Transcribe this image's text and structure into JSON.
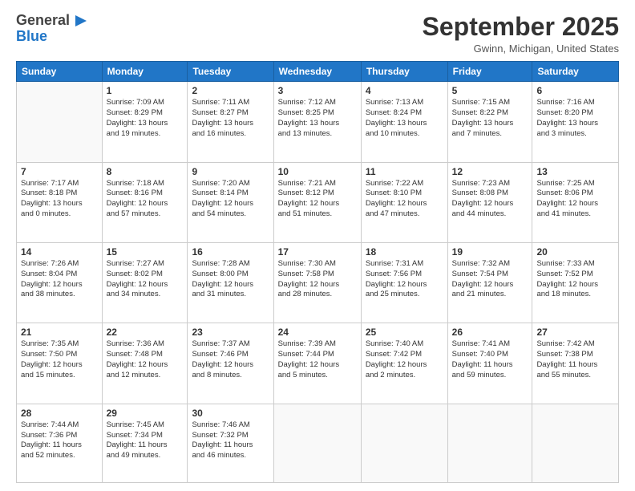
{
  "header": {
    "logo_general": "General",
    "logo_blue": "Blue",
    "month_title": "September 2025",
    "location": "Gwinn, Michigan, United States"
  },
  "calendar": {
    "days_of_week": [
      "Sunday",
      "Monday",
      "Tuesday",
      "Wednesday",
      "Thursday",
      "Friday",
      "Saturday"
    ],
    "weeks": [
      [
        {
          "day": "",
          "info": ""
        },
        {
          "day": "1",
          "info": "Sunrise: 7:09 AM\nSunset: 8:29 PM\nDaylight: 13 hours\nand 19 minutes."
        },
        {
          "day": "2",
          "info": "Sunrise: 7:11 AM\nSunset: 8:27 PM\nDaylight: 13 hours\nand 16 minutes."
        },
        {
          "day": "3",
          "info": "Sunrise: 7:12 AM\nSunset: 8:25 PM\nDaylight: 13 hours\nand 13 minutes."
        },
        {
          "day": "4",
          "info": "Sunrise: 7:13 AM\nSunset: 8:24 PM\nDaylight: 13 hours\nand 10 minutes."
        },
        {
          "day": "5",
          "info": "Sunrise: 7:15 AM\nSunset: 8:22 PM\nDaylight: 13 hours\nand 7 minutes."
        },
        {
          "day": "6",
          "info": "Sunrise: 7:16 AM\nSunset: 8:20 PM\nDaylight: 13 hours\nand 3 minutes."
        }
      ],
      [
        {
          "day": "7",
          "info": "Sunrise: 7:17 AM\nSunset: 8:18 PM\nDaylight: 13 hours\nand 0 minutes."
        },
        {
          "day": "8",
          "info": "Sunrise: 7:18 AM\nSunset: 8:16 PM\nDaylight: 12 hours\nand 57 minutes."
        },
        {
          "day": "9",
          "info": "Sunrise: 7:20 AM\nSunset: 8:14 PM\nDaylight: 12 hours\nand 54 minutes."
        },
        {
          "day": "10",
          "info": "Sunrise: 7:21 AM\nSunset: 8:12 PM\nDaylight: 12 hours\nand 51 minutes."
        },
        {
          "day": "11",
          "info": "Sunrise: 7:22 AM\nSunset: 8:10 PM\nDaylight: 12 hours\nand 47 minutes."
        },
        {
          "day": "12",
          "info": "Sunrise: 7:23 AM\nSunset: 8:08 PM\nDaylight: 12 hours\nand 44 minutes."
        },
        {
          "day": "13",
          "info": "Sunrise: 7:25 AM\nSunset: 8:06 PM\nDaylight: 12 hours\nand 41 minutes."
        }
      ],
      [
        {
          "day": "14",
          "info": "Sunrise: 7:26 AM\nSunset: 8:04 PM\nDaylight: 12 hours\nand 38 minutes."
        },
        {
          "day": "15",
          "info": "Sunrise: 7:27 AM\nSunset: 8:02 PM\nDaylight: 12 hours\nand 34 minutes."
        },
        {
          "day": "16",
          "info": "Sunrise: 7:28 AM\nSunset: 8:00 PM\nDaylight: 12 hours\nand 31 minutes."
        },
        {
          "day": "17",
          "info": "Sunrise: 7:30 AM\nSunset: 7:58 PM\nDaylight: 12 hours\nand 28 minutes."
        },
        {
          "day": "18",
          "info": "Sunrise: 7:31 AM\nSunset: 7:56 PM\nDaylight: 12 hours\nand 25 minutes."
        },
        {
          "day": "19",
          "info": "Sunrise: 7:32 AM\nSunset: 7:54 PM\nDaylight: 12 hours\nand 21 minutes."
        },
        {
          "day": "20",
          "info": "Sunrise: 7:33 AM\nSunset: 7:52 PM\nDaylight: 12 hours\nand 18 minutes."
        }
      ],
      [
        {
          "day": "21",
          "info": "Sunrise: 7:35 AM\nSunset: 7:50 PM\nDaylight: 12 hours\nand 15 minutes."
        },
        {
          "day": "22",
          "info": "Sunrise: 7:36 AM\nSunset: 7:48 PM\nDaylight: 12 hours\nand 12 minutes."
        },
        {
          "day": "23",
          "info": "Sunrise: 7:37 AM\nSunset: 7:46 PM\nDaylight: 12 hours\nand 8 minutes."
        },
        {
          "day": "24",
          "info": "Sunrise: 7:39 AM\nSunset: 7:44 PM\nDaylight: 12 hours\nand 5 minutes."
        },
        {
          "day": "25",
          "info": "Sunrise: 7:40 AM\nSunset: 7:42 PM\nDaylight: 12 hours\nand 2 minutes."
        },
        {
          "day": "26",
          "info": "Sunrise: 7:41 AM\nSunset: 7:40 PM\nDaylight: 11 hours\nand 59 minutes."
        },
        {
          "day": "27",
          "info": "Sunrise: 7:42 AM\nSunset: 7:38 PM\nDaylight: 11 hours\nand 55 minutes."
        }
      ],
      [
        {
          "day": "28",
          "info": "Sunrise: 7:44 AM\nSunset: 7:36 PM\nDaylight: 11 hours\nand 52 minutes."
        },
        {
          "day": "29",
          "info": "Sunrise: 7:45 AM\nSunset: 7:34 PM\nDaylight: 11 hours\nand 49 minutes."
        },
        {
          "day": "30",
          "info": "Sunrise: 7:46 AM\nSunset: 7:32 PM\nDaylight: 11 hours\nand 46 minutes."
        },
        {
          "day": "",
          "info": ""
        },
        {
          "day": "",
          "info": ""
        },
        {
          "day": "",
          "info": ""
        },
        {
          "day": "",
          "info": ""
        }
      ]
    ]
  }
}
